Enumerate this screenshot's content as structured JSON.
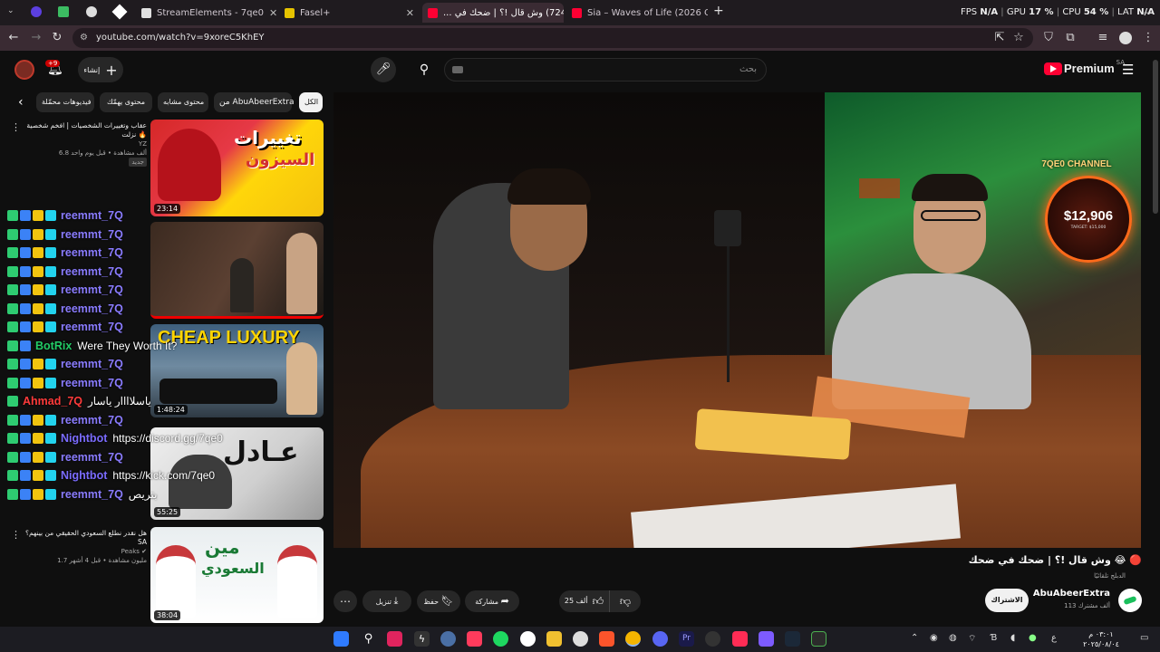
{
  "browser": {
    "tabs": [
      {
        "label": "StreamElements - 7qe0",
        "active": false
      },
      {
        "label": "Fasel+",
        "active": false
      },
      {
        "label": "(724) وش قال !؟ | ضحك في ...",
        "active": true
      },
      {
        "label": "Sia – Waves of Life (2026 Officia...",
        "active": false
      }
    ],
    "new_tab": "+",
    "url": "youtube.com/watch?v=9xoreC5KhEY",
    "stats_overlay": {
      "fps_label": "FPS",
      "fps_value": "N/A",
      "gpu_label": "GPU",
      "gpu_value": "17 %",
      "cpu_label": "CPU",
      "cpu_value": "54 %",
      "lat_label": "LAT",
      "lat_value": "N/A"
    }
  },
  "youtube": {
    "brand": "Premium",
    "region": "SA",
    "create_label": "إنشاء",
    "notif_count": "+9",
    "search_placeholder": "بحث"
  },
  "chips": [
    "الكل",
    "من AbuAbeerExtra",
    "محتوى مشابه",
    "محتوى يهمّك",
    "فيديوهات محمّلة"
  ],
  "related": [
    {
      "title": "عقاب وتغييرات الشخصيات | افخم شخصية نزلت 🔥",
      "channel": "YZ",
      "meta": "6.8 ألف مشاهدة • قبل يوم واحد",
      "badge": "جديد",
      "duration": "23:14"
    },
    {
      "title": "",
      "channel": "",
      "meta": "",
      "badge": "",
      "duration": ""
    },
    {
      "title": "",
      "channel": "",
      "meta": "",
      "badge": "",
      "duration": "1:48:24"
    },
    {
      "title": "",
      "channel": "",
      "meta": "",
      "badge": "",
      "duration": "55:25"
    },
    {
      "title": "هل نقدر نطلع السعودي الحقيقي من بينهم؟ SA",
      "channel": "Peaks ✔",
      "meta": "1.7 مليون مشاهدة • قبل 4 أشهر",
      "badge": "",
      "duration": "38:04"
    }
  ],
  "chat": [
    {
      "user": "reemmt_7Q",
      "msg": "",
      "color": "#8a7cff"
    },
    {
      "user": "reemmt_7Q",
      "msg": "",
      "color": "#8a7cff"
    },
    {
      "user": "reemmt_7Q",
      "msg": "",
      "color": "#8a7cff"
    },
    {
      "user": "reemmt_7Q",
      "msg": "",
      "color": "#8a7cff"
    },
    {
      "user": "reemmt_7Q",
      "msg": "",
      "color": "#8a7cff"
    },
    {
      "user": "reemmt_7Q",
      "msg": "",
      "color": "#8a7cff"
    },
    {
      "user": "reemmt_7Q",
      "msg": "",
      "color": "#8a7cff"
    },
    {
      "user": "BotRix",
      "msg": "Were They Worth It?",
      "color": "#22cc66"
    },
    {
      "user": "reemmt_7Q",
      "msg": "",
      "color": "#8a7cff"
    },
    {
      "user": "reemmt_7Q",
      "msg": "",
      "color": "#8a7cff"
    },
    {
      "user": "Ahmad_7Q",
      "msg": "ياسلاااار ياسار",
      "color": "#ff3b3b"
    },
    {
      "user": "reemmt_7Q",
      "msg": "",
      "color": "#8a7cff"
    },
    {
      "user": "Nightbot",
      "msg": "https://discord.gg/7qe0",
      "color": "#7b6cff"
    },
    {
      "user": "reemmt_7Q",
      "msg": "",
      "color": "#8a7cff"
    },
    {
      "user": "Nightbot",
      "msg": "https://kick.com/7qe0",
      "color": "#7b6cff"
    },
    {
      "user": "reemmt_7Q",
      "msg": "بتريص",
      "color": "#8a7cff"
    }
  ],
  "video": {
    "title": "وش قال !؟ | ضحك في ضحك 😂 🔴",
    "subtitle": "الدبلج تلقائيًا",
    "overlay_channel": "7QE0 CHANNEL",
    "overlay_amount": "$12,906",
    "overlay_target": "TARGET: $15,000",
    "channel_name": "AbuAbeerExtra",
    "subscribers": "113 ألف مشترك",
    "subscribe_label": "الاشتراك",
    "likes": "25 ألف",
    "share_label": "مشاركة",
    "save_label": "حفظ",
    "download_label": "تنزيل"
  },
  "taskbar": {
    "lang": "ع",
    "time": "٠٣:٠١ م",
    "date": "٢٠٢٥/٠٨/٠٤"
  },
  "colors": {
    "youtube_red": "#ff0033",
    "chrome_tab_bg": "#3a2b33",
    "chat_user_reem": "#8a7cff"
  }
}
